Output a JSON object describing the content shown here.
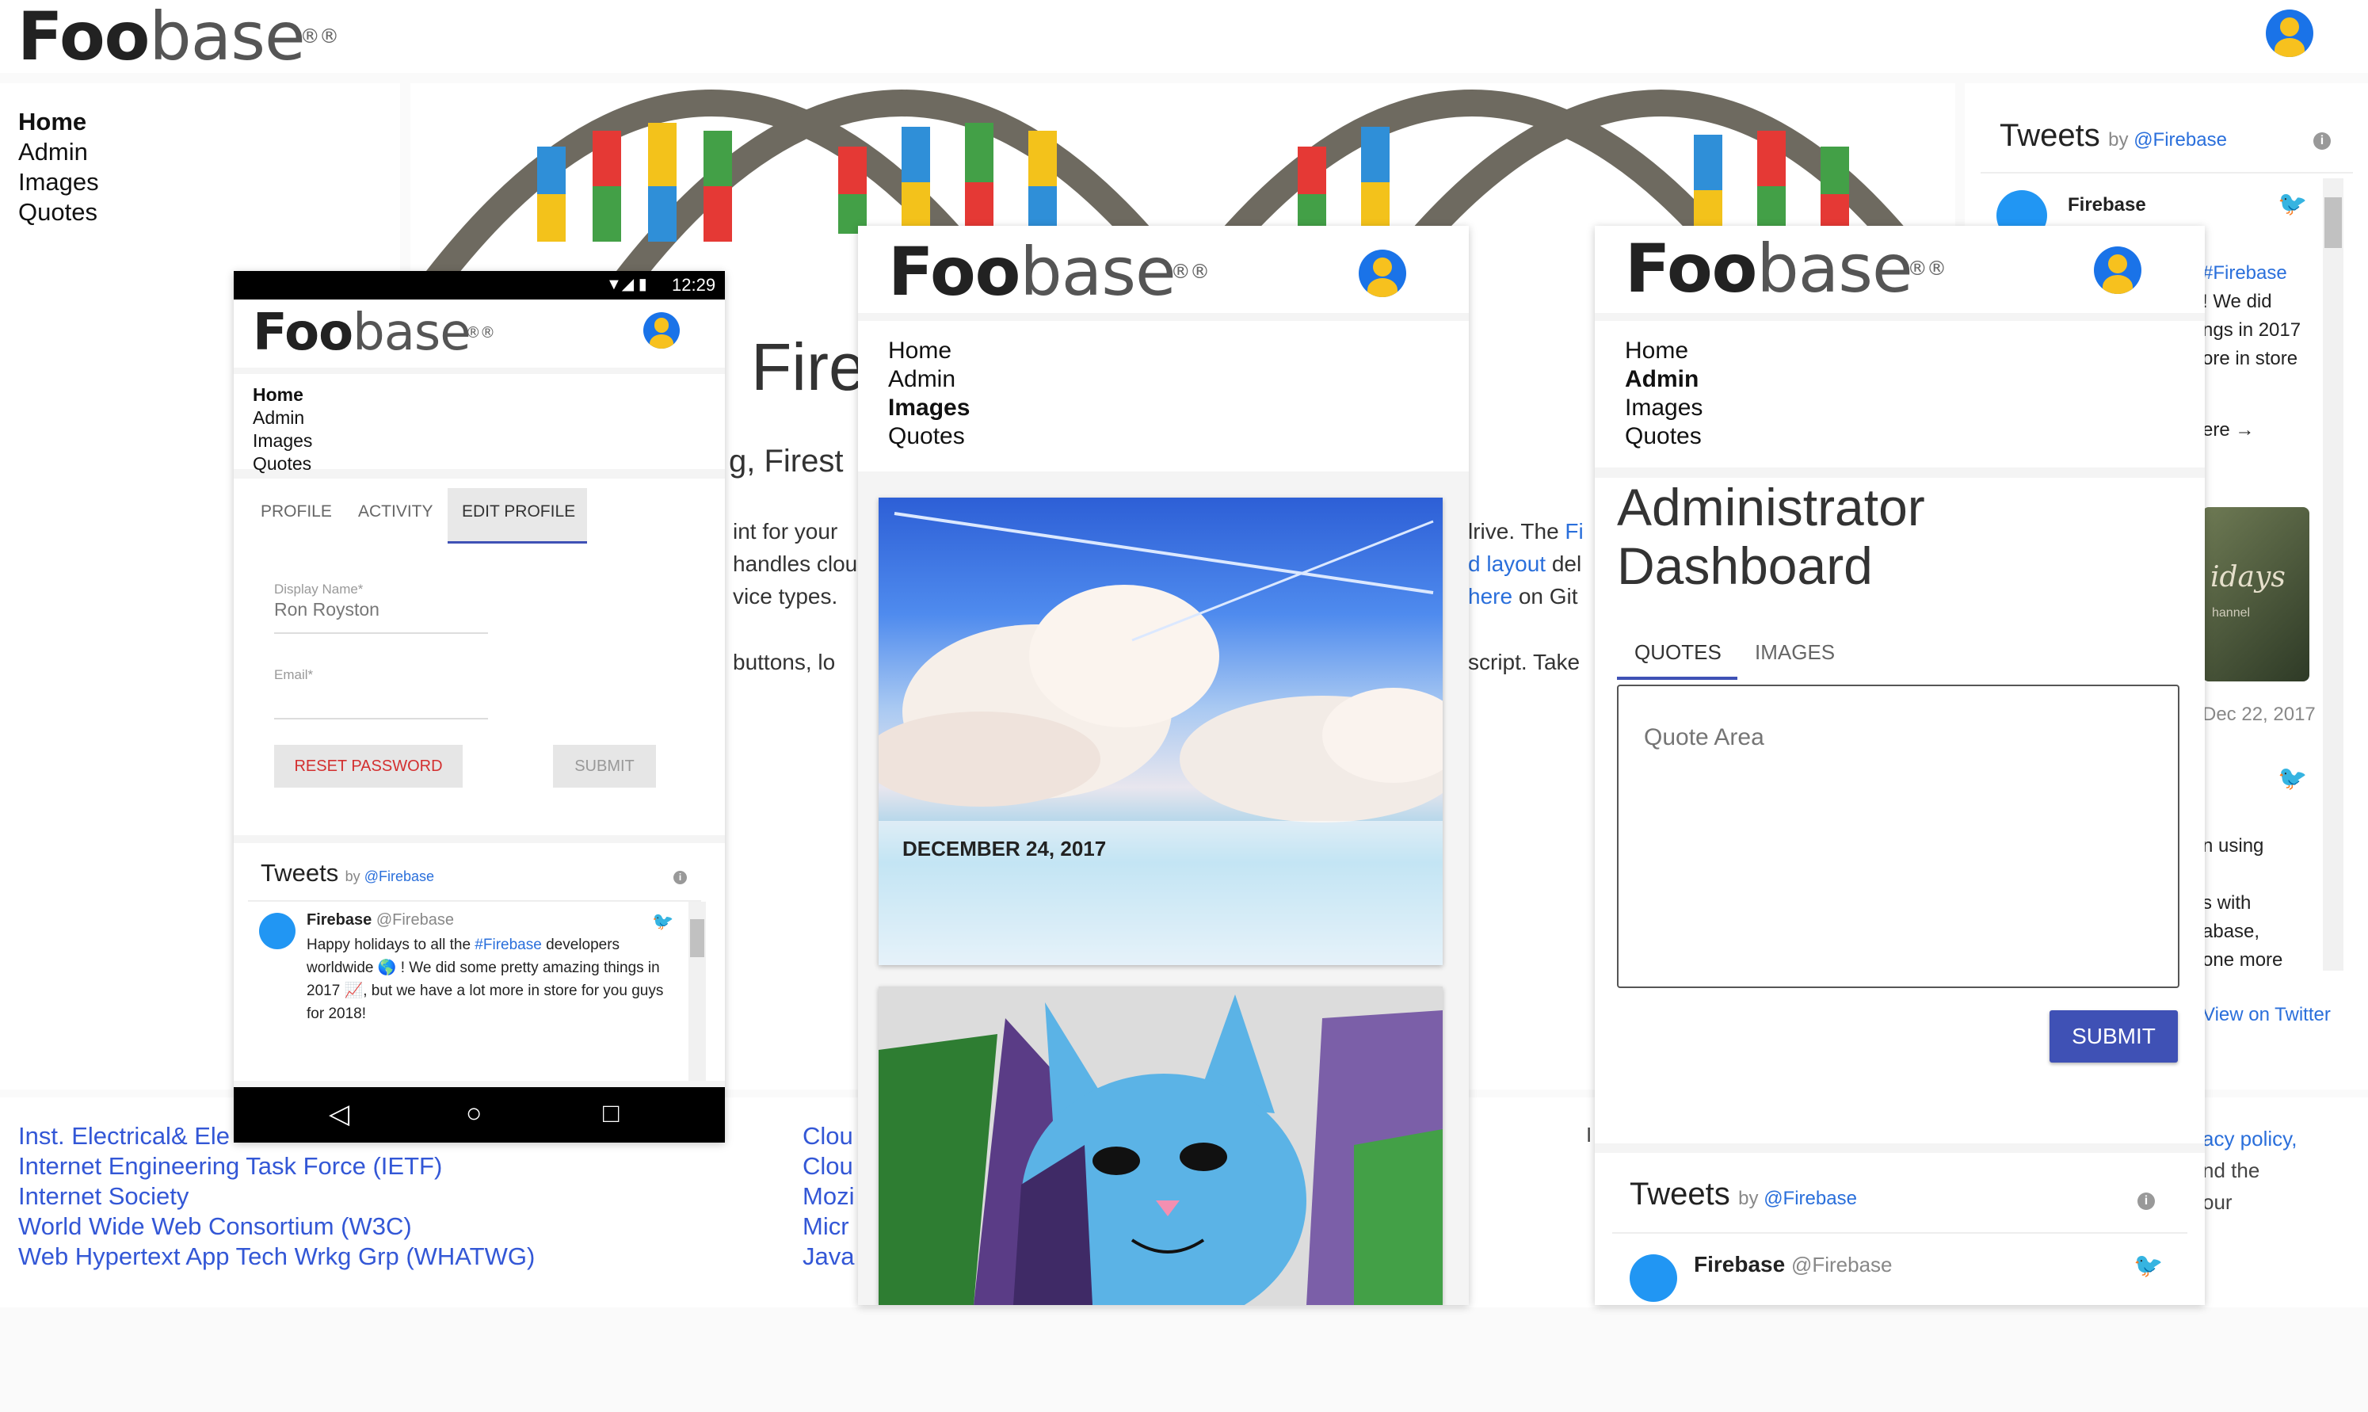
{
  "brand": {
    "bold": "Foo",
    "light": "base",
    "mark": "®®"
  },
  "nav": {
    "home": "Home",
    "admin": "Admin",
    "images": "Images",
    "quotes": "Quotes"
  },
  "hero": {
    "title_fragment": "Fire",
    "subtitle_fragment": "g, Firest",
    "left_lines": [
      "int for your",
      "handles clou",
      "vice types.",
      "buttons, lo"
    ],
    "right_lines": [
      "lrive. The",
      "d layout",
      "here",
      "script. Take"
    ],
    "right_link_1": "Fi",
    "right_line_2_suffix": " del",
    "right_line_3_suffix": " on Git"
  },
  "phone": {
    "status_time": "12:29",
    "tabs": {
      "profile": "PROFILE",
      "activity": "ACTIVITY",
      "edit": "EDIT PROFILE"
    },
    "display_name_label": "Display Name*",
    "display_name_value": "Ron Royston",
    "email_label": "Email*",
    "email_value": "",
    "reset_label": "RESET PASSWORD",
    "submit_label": "SUBMIT",
    "tweet_author": "Firebase",
    "tweet_handle": "@Firebase",
    "tweet_text_a": "Happy holidays to all the ",
    "tweet_hashtag": "#Firebase",
    "tweet_text_b": " developers worldwide 🌎 ! We did some pretty amazing things in 2017 📈, but we have a lot more in store for you guys for 2018!"
  },
  "tweets": {
    "title": "Tweets",
    "by": "by ",
    "handle": "@Firebase",
    "author": "Firebase",
    "snippets": [
      "#Firebase",
      "! We did",
      "ngs in 2017",
      "ore in store",
      "ere →"
    ],
    "image_text_1": "idays",
    "image_text_2": "hannel",
    "date": "Dec 22, 2017",
    "snippets2": [
      "n using",
      "s with",
      "abase,",
      "one more"
    ],
    "view_on_twitter": "View on Twitter"
  },
  "images_panel": {
    "date_label": "DECEMBER 24, 2017"
  },
  "admin": {
    "title_line1": "Administrator",
    "title_line2": "Dashboard",
    "tabs": {
      "quotes": "QUOTES",
      "images": "IMAGES"
    },
    "quote_placeholder": "Quote Area",
    "submit_label": "SUBMIT"
  },
  "footer": {
    "col1": [
      "Inst. Electrical& Ele",
      "Internet Engineering Task Force (IETF)",
      "Internet Society",
      "World Wide Web Consortium (W3C)",
      "Web Hypertext App Tech Wrkg Grp (WHATWG)"
    ],
    "col2": [
      "Clou",
      "Clou",
      "Mozi",
      "Micr",
      "Java"
    ],
    "col3_mark": "I",
    "col4": [
      "acy policy,",
      "nd the",
      "our"
    ]
  },
  "colors": {
    "accent_blue": "#3f51b5",
    "link_blue": "#2a6fdb",
    "reset_red": "#d32f2f"
  }
}
